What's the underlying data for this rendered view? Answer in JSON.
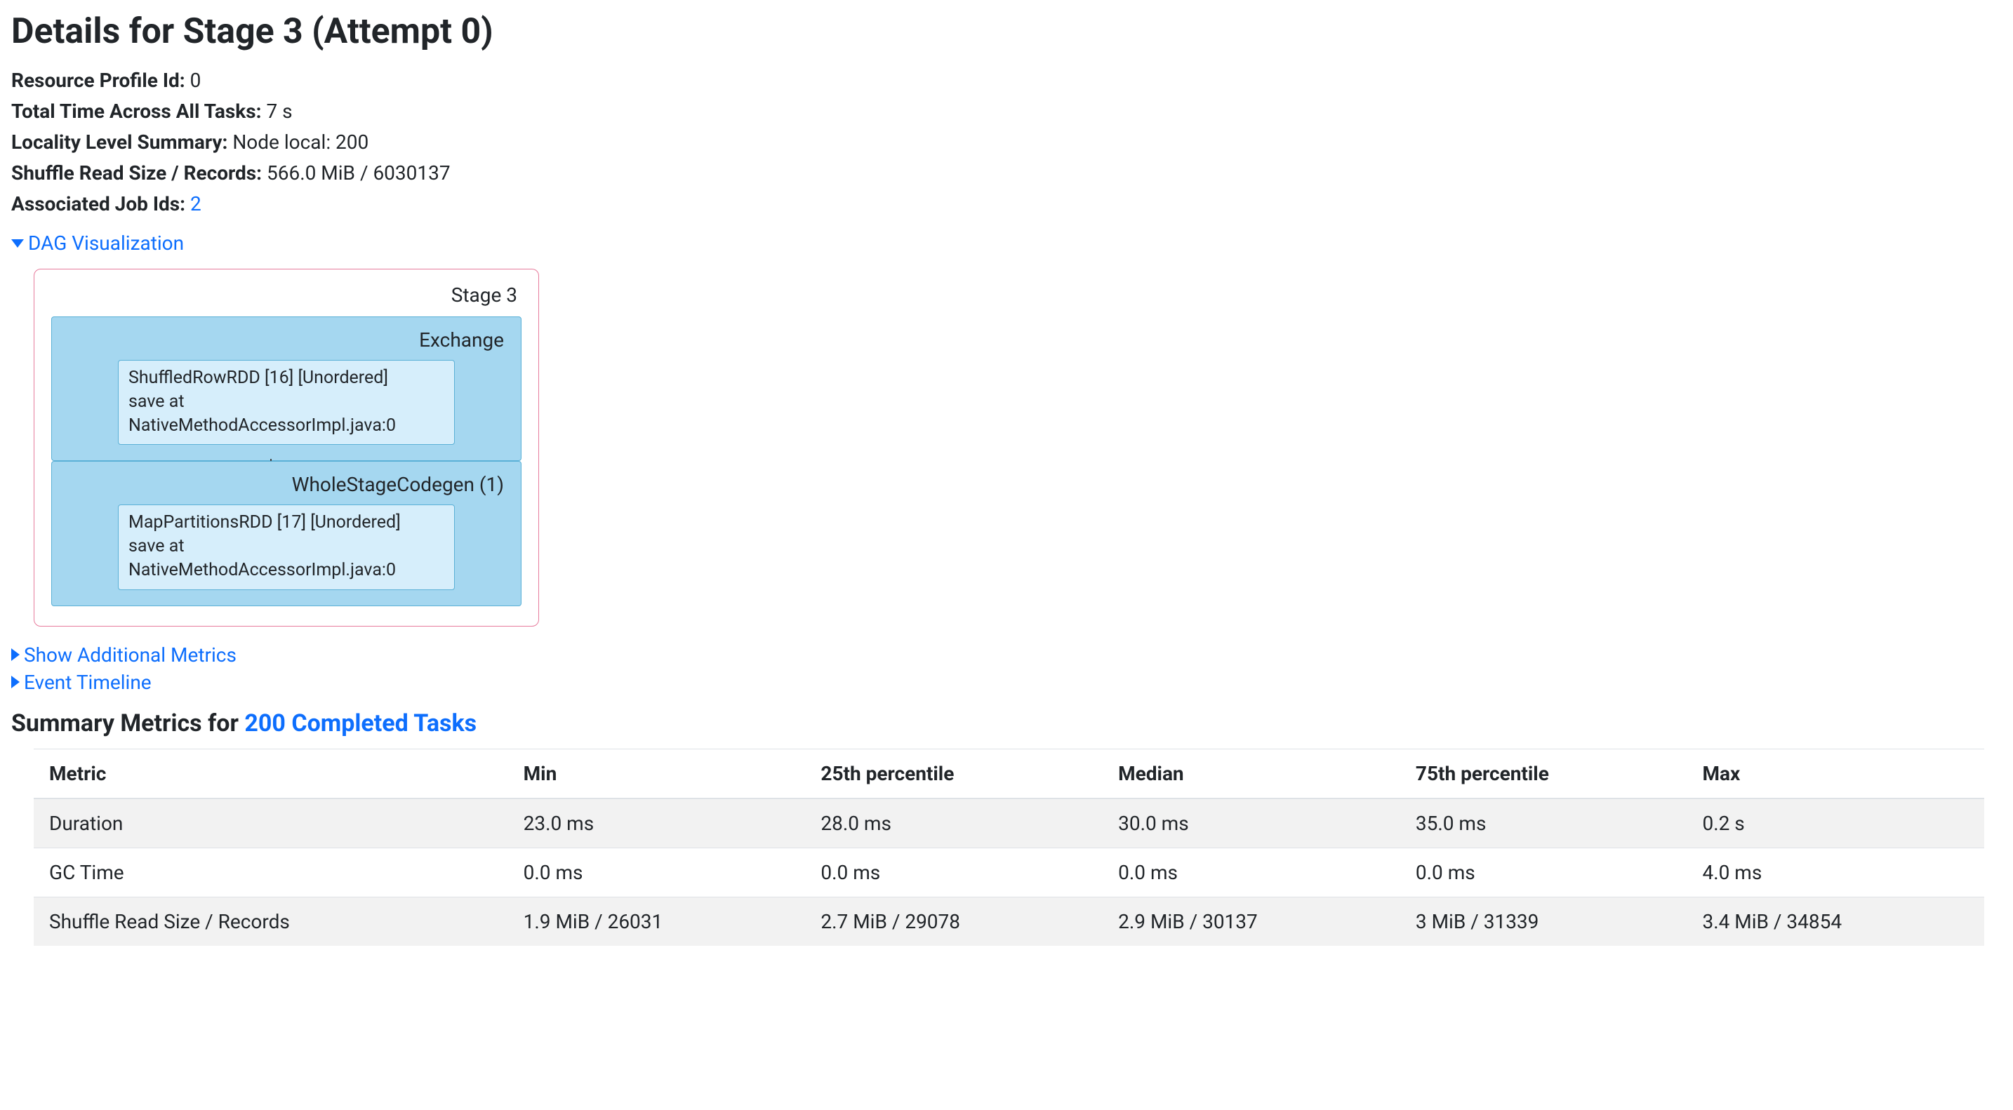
{
  "title": "Details for Stage 3 (Attempt 0)",
  "info": {
    "resource_profile_id": {
      "label": "Resource Profile Id:",
      "value": "0"
    },
    "total_time": {
      "label": "Total Time Across All Tasks:",
      "value": "7 s"
    },
    "locality": {
      "label": "Locality Level Summary:",
      "value": "Node local: 200"
    },
    "shuffle_read": {
      "label": "Shuffle Read Size / Records:",
      "value": "566.0 MiB / 6030137"
    },
    "assoc_jobs": {
      "label": "Associated Job Ids:",
      "link_text": "2"
    }
  },
  "expanders": {
    "dag": "DAG Visualization",
    "show_additional": "Show Additional Metrics",
    "event_timeline": "Event Timeline"
  },
  "dag": {
    "stage_label": "Stage 3",
    "groups": [
      {
        "label": "Exchange",
        "node_line1": "ShuffledRowRDD [16] [Unordered]",
        "node_line2": "save at NativeMethodAccessorImpl.java:0"
      },
      {
        "label": "WholeStageCodegen (1)",
        "node_line1": "MapPartitionsRDD [17] [Unordered]",
        "node_line2": "save at NativeMethodAccessorImpl.java:0"
      }
    ]
  },
  "summary_heading": {
    "prefix": "Summary Metrics for ",
    "link": "200 Completed Tasks"
  },
  "metrics_table": {
    "headers": [
      "Metric",
      "Min",
      "25th percentile",
      "Median",
      "75th percentile",
      "Max"
    ],
    "rows": [
      [
        "Duration",
        "23.0 ms",
        "28.0 ms",
        "30.0 ms",
        "35.0 ms",
        "0.2 s"
      ],
      [
        "GC Time",
        "0.0 ms",
        "0.0 ms",
        "0.0 ms",
        "0.0 ms",
        "4.0 ms"
      ],
      [
        "Shuffle Read Size / Records",
        "1.9 MiB / 26031",
        "2.7 MiB / 29078",
        "2.9 MiB / 30137",
        "3 MiB / 31339",
        "3.4 MiB / 34854"
      ]
    ]
  }
}
